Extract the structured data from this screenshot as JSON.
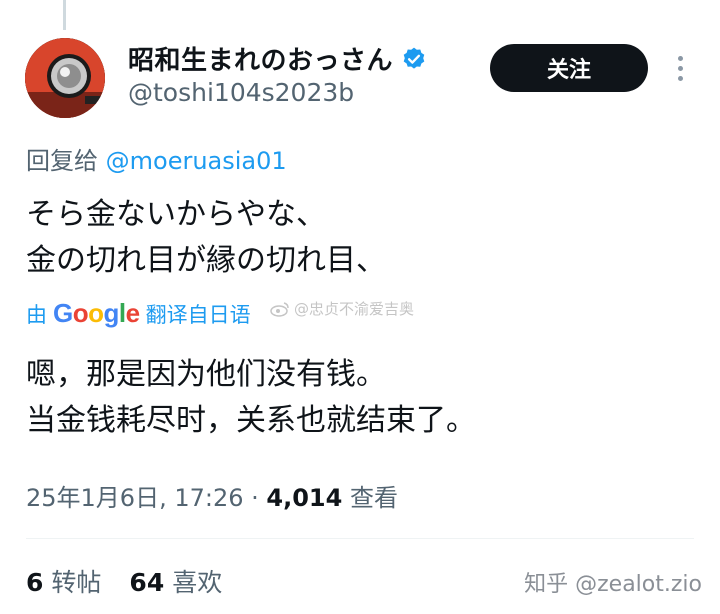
{
  "author": {
    "display_name": "昭和生まれのおっさん",
    "handle": "@toshi104s2023b",
    "verified": true
  },
  "actions": {
    "follow_label": "关注",
    "more_icon": "more-vertical-icon"
  },
  "reply": {
    "prefix": "回复给 ",
    "mention": "@moeruasia01"
  },
  "tweet": {
    "original_lines": [
      "そら金ないからやな、",
      "金の切れ目が縁の切れ目、"
    ],
    "translate_prefix": "由",
    "translate_brand": "Google",
    "translate_suffix": "翻译自日语",
    "translated_lines": [
      "嗯，那是因为他们没有钱。",
      "当金钱耗尽时，关系也就结束了。"
    ]
  },
  "meta": {
    "timestamp": "25年1月6日, 17:26 · ",
    "views_count": "4,014",
    "views_label": " 查看"
  },
  "stats": {
    "reposts_count": "6",
    "reposts_label": "转帖",
    "likes_count": "64",
    "likes_label": "喜欢"
  },
  "watermarks": {
    "weibo": "@忠贞不渝爱吉奥",
    "zhihu": "知乎 @zealot.zio"
  },
  "colors": {
    "link_blue": "#1d9bf0",
    "text_primary": "#0f1419",
    "text_secondary": "#536471",
    "button_bg": "#0f1419"
  }
}
